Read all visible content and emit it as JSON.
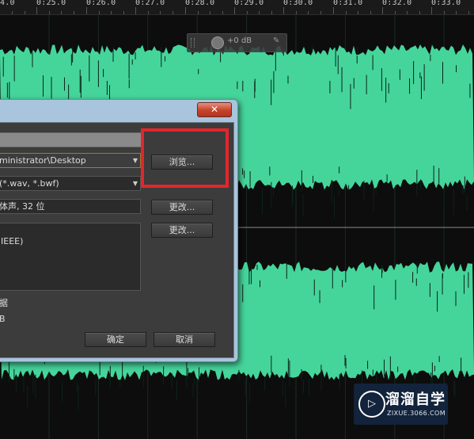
{
  "timeline": {
    "labels": [
      "4.0",
      "0:25.0",
      "0:26.0",
      "0:27.0",
      "0:28.0",
      "0:29.0",
      "0:30.0",
      "0:31.0",
      "0:32.0",
      "0:33.0"
    ]
  },
  "hud": {
    "volume_label": "+0 dB"
  },
  "waveform": {
    "color": "#45d59b"
  },
  "dialog": {
    "folder_value": "ministrator\\Desktop",
    "browse_label": "浏览...",
    "format_value": "(*.wav, *.bwf)",
    "sample_type_value": "体声, 32 位",
    "change_label_1": "更改...",
    "change_label_2": "更改...",
    "format_settings_text": "IEEE)",
    "metadata_label": "据",
    "size_text": "B",
    "ok_label": "确定",
    "cancel_label": "取消"
  },
  "watermark": {
    "title": "溜溜自学",
    "url": "ZIXUE.3066.COM"
  }
}
